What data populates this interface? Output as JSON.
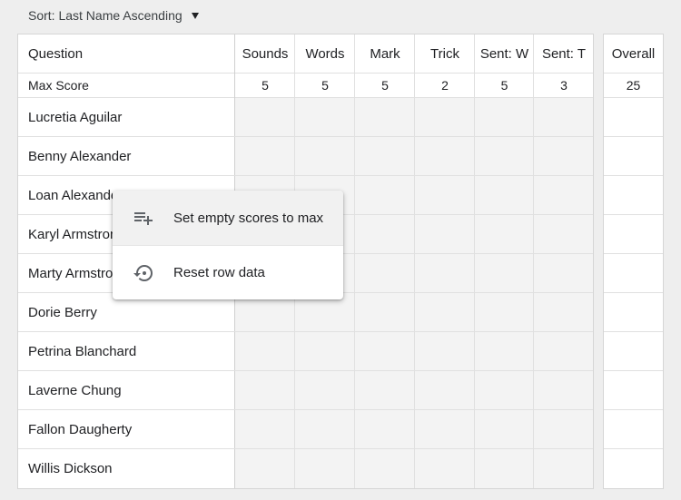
{
  "sort": {
    "label": "Sort: Last Name Ascending"
  },
  "table": {
    "header_label": "Question",
    "max_label": "Max Score",
    "columns": [
      "Sounds",
      "Words",
      "Mark",
      "Trick",
      "Sent: W",
      "Sent: T"
    ],
    "max_scores": [
      "5",
      "5",
      "5",
      "2",
      "5",
      "3"
    ],
    "overall": {
      "label": "Overall",
      "max": "25"
    },
    "students": [
      "Lucretia Aguilar",
      "Benny Alexander",
      "Loan Alexander",
      "Karyl Armstrong",
      "Marty Armstrong",
      "Dorie Berry",
      "Petrina Blanchard",
      "Laverne Chung",
      "Fallon Daugherty",
      "Willis Dickson"
    ]
  },
  "context_menu": {
    "items": [
      {
        "label": "Set empty scores to max",
        "icon": "playlist-add-icon"
      },
      {
        "label": "Reset row data",
        "icon": "history-icon"
      }
    ]
  },
  "colors": {
    "icon": "#5f6368",
    "score_bg": "#f3f3f3",
    "grid": "#e0e0e0"
  }
}
